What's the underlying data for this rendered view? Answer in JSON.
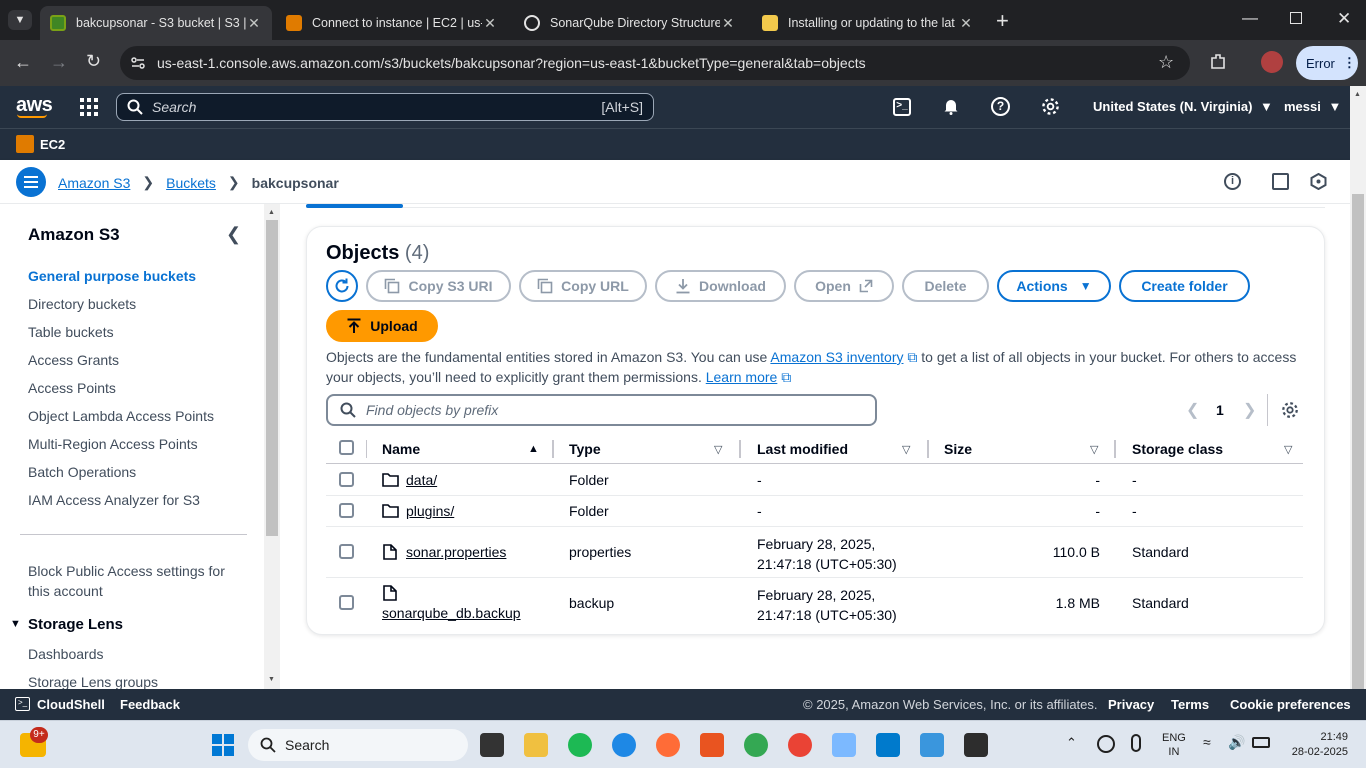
{
  "browser": {
    "tabs": [
      {
        "title": "bakcupsonar - S3 bucket | S3 | u",
        "active": true
      },
      {
        "title": "Connect to instance | EC2 | us-e",
        "active": false
      },
      {
        "title": "SonarQube Directory Structure",
        "active": false
      },
      {
        "title": "Installing or updating to the lat",
        "active": false
      }
    ],
    "url": "us-east-1.console.aws.amazon.com/s3/buckets/bakcupsonar?region=us-east-1&bucketType=general&tab=objects",
    "profile_button": "Error"
  },
  "aws_header": {
    "logo": "aws",
    "search_placeholder": "Search",
    "search_shortcut": "[Alt+S]",
    "region": "United States (N. Virginia)",
    "user": "messi",
    "favorite_service": "EC2"
  },
  "breadcrumb": [
    "Amazon S3",
    "Buckets",
    "bakcupsonar"
  ],
  "sidenav": {
    "title": "Amazon S3",
    "items": [
      "General purpose buckets",
      "Directory buckets",
      "Table buckets",
      "Access Grants",
      "Access Points",
      "Object Lambda Access Points",
      "Multi-Region Access Points",
      "Batch Operations",
      "IAM Access Analyzer for S3"
    ],
    "block_public_access": "Block Public Access settings for this account",
    "section_storage_lens": "Storage Lens",
    "storage_lens_items": [
      "Dashboards",
      "Storage Lens groups"
    ]
  },
  "objects": {
    "heading": "Objects",
    "count": "(4)",
    "buttons": {
      "copy_s3_uri": "Copy S3 URI",
      "copy_url": "Copy URL",
      "download": "Download",
      "open": "Open",
      "delete": "Delete",
      "actions": "Actions",
      "create_folder": "Create folder",
      "upload": "Upload"
    },
    "description_part1": "Objects are the fundamental entities stored in Amazon S3. You can use",
    "inventory_link": "Amazon S3 inventory",
    "description_part2": "to get a list of all objects in your bucket. For others to",
    "description_part3": "access your objects, you’ll need to explicitly grant them permissions.",
    "learn_more": "Learn more",
    "filter_placeholder": "Find objects by prefix",
    "page": "1",
    "columns": [
      "Name",
      "Type",
      "Last modified",
      "Size",
      "Storage class"
    ],
    "rows": [
      {
        "name": "data/",
        "kind": "folder",
        "type": "Folder",
        "modified_1": "-",
        "modified_2": "",
        "size": "-",
        "class": "-"
      },
      {
        "name": "plugins/",
        "kind": "folder",
        "type": "Folder",
        "modified_1": "-",
        "modified_2": "",
        "size": "-",
        "class": "-"
      },
      {
        "name": "sonar.properties",
        "kind": "file",
        "type": "properties",
        "modified_1": "February 28, 2025,",
        "modified_2": "21:47:18 (UTC+05:30)",
        "size": "110.0 B",
        "class": "Standard"
      },
      {
        "name": "sonarqube_db.backup",
        "kind": "file",
        "type": "backup",
        "modified_1": "February 28, 2025,",
        "modified_2": "21:47:18 (UTC+05:30)",
        "size": "1.8 MB",
        "class": "Standard"
      }
    ]
  },
  "footer": {
    "cloudshell": "CloudShell",
    "feedback": "Feedback",
    "copyright": "© 2025, Amazon Web Services, Inc. or its affiliates.",
    "privacy": "Privacy",
    "terms": "Terms",
    "cookie": "Cookie preferences"
  },
  "taskbar": {
    "notification_badge": "9+",
    "search": "Search",
    "lang_1": "ENG",
    "lang_2": "IN",
    "time": "21:49",
    "date": "28-02-2025"
  },
  "colors": {
    "aws_nav": "#232f3e",
    "link": "#0972d3",
    "orange": "#ff9900"
  }
}
